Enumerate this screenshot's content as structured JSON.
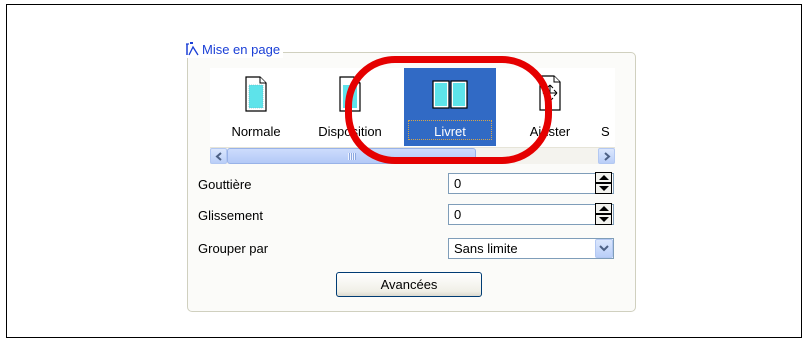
{
  "group": {
    "title": "Mise en page"
  },
  "modes": [
    {
      "label": "Normale",
      "selected": false
    },
    {
      "label": "Disposition",
      "selected": false
    },
    {
      "label": "Livret",
      "selected": true
    },
    {
      "label": "Ajuster",
      "selected": false
    },
    {
      "label": "S",
      "selected": false
    }
  ],
  "fields": {
    "gouttiere": {
      "label": "Gouttière",
      "value": "0"
    },
    "glissement": {
      "label": "Glissement",
      "value": "0"
    },
    "grouper": {
      "label": "Grouper par",
      "value": "Sans limite"
    }
  },
  "buttons": {
    "advanced_label": "Avancées"
  },
  "colors": {
    "selection": "#316ac5",
    "highlight": "#e50000",
    "legend_text": "#1a3fd6",
    "page_cyan": "#5ee3ea"
  },
  "icons": {
    "legend": "page-layout-icon",
    "scroll_left": "chevron-left-icon",
    "scroll_right": "chevron-right-icon",
    "spin_up": "spin-up-icon",
    "spin_down": "spin-down-icon",
    "dropdown": "chevron-down-icon"
  }
}
